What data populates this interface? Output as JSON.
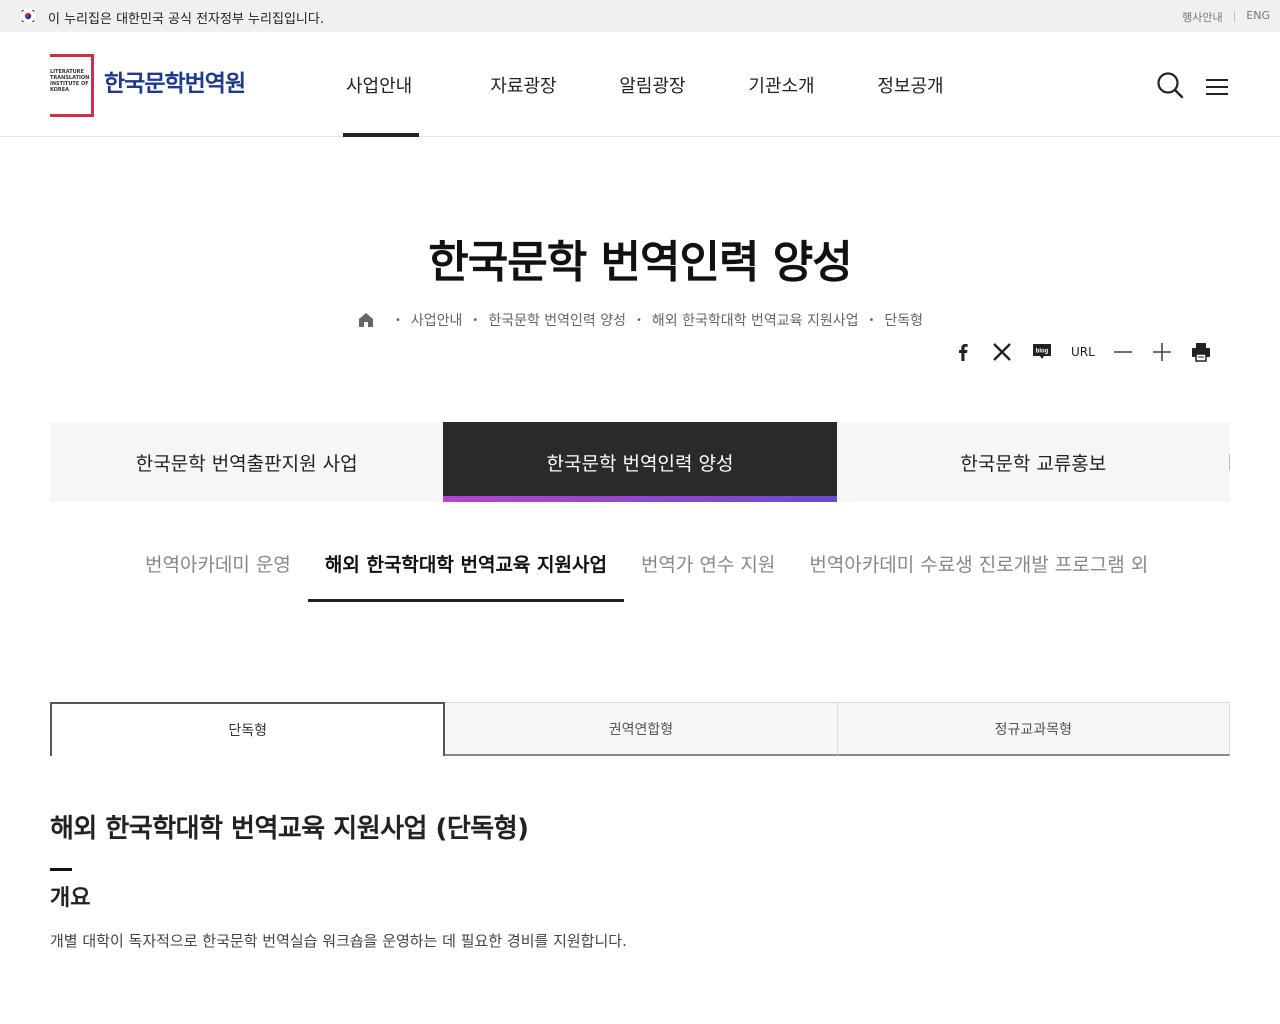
{
  "gov_banner": {
    "text": "이 누리집은 대한민국 공식 전자정부 누리집입니다.",
    "util_links": [
      "행사안내",
      "ENG"
    ]
  },
  "header": {
    "logo_text": "한국문학번역원",
    "logo_mark_text": "LITERATURE TRANSLATION INSTITUTE OF KOREA",
    "nav": [
      "사업안내",
      "자료광장",
      "알림광장",
      "기관소개",
      "정보공개"
    ],
    "active_nav": "사업안내"
  },
  "page": {
    "title": "한국문학 번역인력 양성",
    "breadcrumb": [
      "사업안내",
      "한국문학 번역인력 양성",
      "해외 한국학대학 번역교육 지원사업",
      "단독형"
    ]
  },
  "share": {
    "items": [
      "facebook-icon",
      "x-icon",
      "blog-icon",
      "URL",
      "zoom-out-icon",
      "zoom-in-icon",
      "print-icon"
    ],
    "url_label": "URL",
    "blog_label": "blog"
  },
  "depth2_tabs": [
    "한국문학 번역출판지원 사업",
    "한국문학 번역인력 양성",
    "한국문학 교류홍보"
  ],
  "depth3_tabs": [
    "번역아카데미 운영",
    "해외 한국학대학 번역교육 지원사업",
    "번역가 연수 지원",
    "번역아카데미 수료생 진로개발 프로그램 외"
  ],
  "type_tabs": [
    "단독형",
    "권역연합형",
    "정규교과목형"
  ],
  "content": {
    "title": "해외 한국학대학 번역교육 지원사업 (단독형)",
    "section_heading": "개요",
    "description": "개별 대학이 독자적으로 한국문학 번역실습 워크숍을 운영하는 데 필요한 경비를 지원합니다."
  },
  "colors": {
    "brand_red": "#d32b4a",
    "brand_navy": "#1f3a8a",
    "active_tab_bg": "#2a2a2a",
    "accent_gradient_start": "#b644d0",
    "accent_gradient_end": "#6a4bcc"
  }
}
